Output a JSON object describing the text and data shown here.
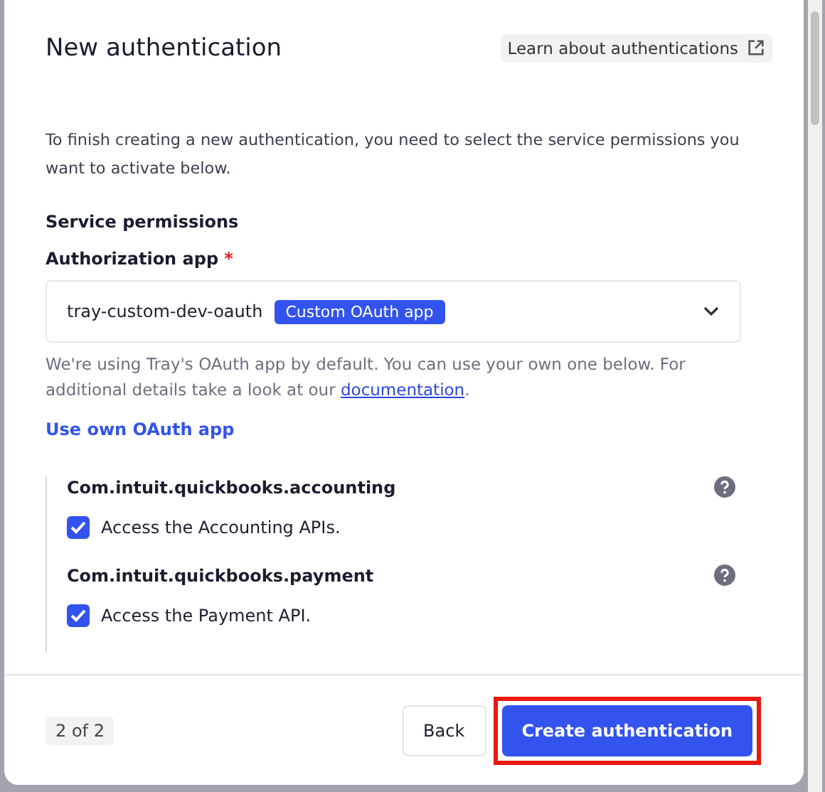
{
  "dialog": {
    "title": "New authentication",
    "learn_link": "Learn about authentications"
  },
  "intro": "To finish creating a new authentication, you need to select the service permissions you want to activate below.",
  "section_title": "Service permissions",
  "auth_app": {
    "label": "Authorization app",
    "required_mark": "*",
    "value": "tray-custom-dev-oauth",
    "badge": "Custom OAuth app"
  },
  "help_text": "We're using Tray's OAuth app by default. You can use your own one below. For additional details take a look at our ",
  "help_link": "documentation",
  "help_end": ".",
  "own_app_link": "Use own OAuth app",
  "scopes": [
    {
      "title": "Com.intuit.quickbooks.accounting",
      "option": "Access the Accounting APIs.",
      "checked": true
    },
    {
      "title": "Com.intuit.quickbooks.payment",
      "option": "Access the Payment API.",
      "checked": true
    }
  ],
  "footer": {
    "step": "2 of 2",
    "back": "Back",
    "create": "Create authentication",
    "create_highlighted": true
  }
}
